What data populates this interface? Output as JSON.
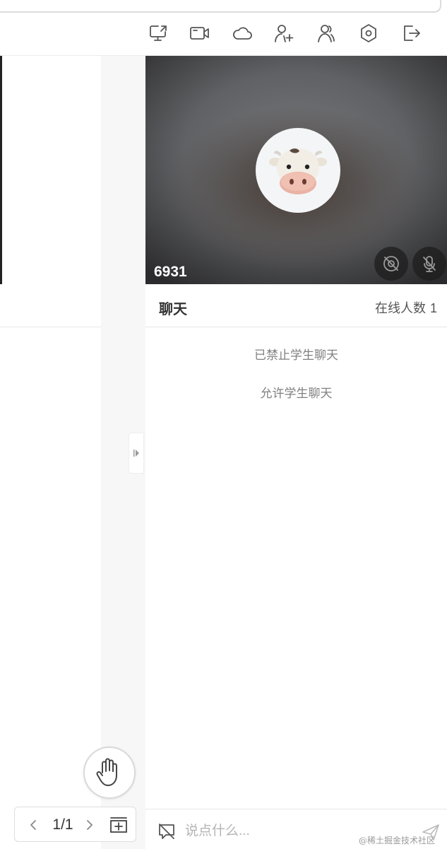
{
  "toolbar": {
    "icons": [
      "screen-share-icon",
      "video-record-icon",
      "cloud-icon",
      "add-user-icon",
      "users-icon",
      "settings-icon",
      "exit-icon"
    ]
  },
  "pager": {
    "page_text": "1/1"
  },
  "video": {
    "user_id": "6931",
    "avatar": "cow-avatar-icon"
  },
  "chat": {
    "title": "聊天",
    "online_label": "在线人数",
    "online_count": "1",
    "messages": [
      "已禁止学生聊天",
      "允许学生聊天"
    ],
    "input_placeholder": "说点什么..."
  },
  "watermark": "@稀土掘金技术社区",
  "colors": {
    "icon_stroke": "#555555",
    "panel_gray": "#f7f7f7",
    "message_text": "#808080"
  }
}
